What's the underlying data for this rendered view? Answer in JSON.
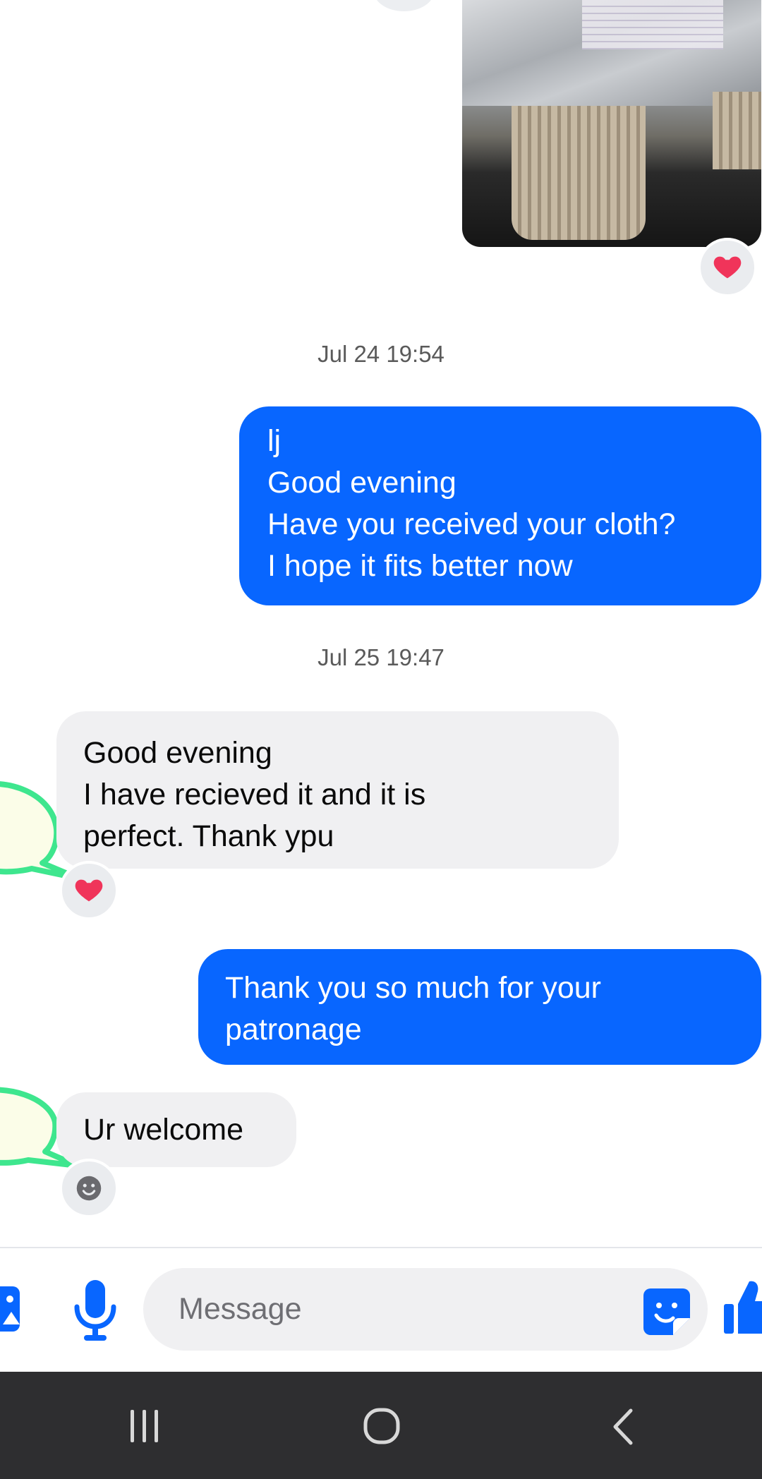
{
  "timestamps": [
    "Jul 24 19:54",
    "Jul 25 19:47"
  ],
  "messages": {
    "outgoing_1": "lj\nGood evening\nHave you received your cloth?\nI hope it fits better now",
    "incoming_1": "Good evening\nI have recieved it and it is\nperfect. Thank ypu",
    "outgoing_2": "Thank you so much for your\npatronage",
    "incoming_2": "Ur welcome"
  },
  "reactions": {
    "photo": "heart",
    "incoming_1": "heart",
    "incoming_2": "smiley-placeholder"
  },
  "composer": {
    "placeholder": "Message"
  },
  "colors": {
    "outgoing_bubble": "#0866ff",
    "incoming_bubble": "#f0f0f2",
    "accent_blue": "#0866ff",
    "heart": "#f0345a",
    "speech_outline": "#3ee68e",
    "speech_fill": "#fbfde8",
    "navbar": "#2e2e30"
  },
  "icons": {
    "composer": [
      "gallery-icon",
      "microphone-icon",
      "sticker-icon",
      "thumbs-up-icon"
    ],
    "navbar": [
      "recent-apps-icon",
      "home-icon",
      "back-icon"
    ]
  }
}
